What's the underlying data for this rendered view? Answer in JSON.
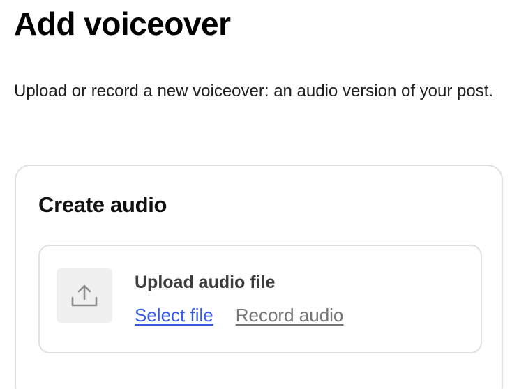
{
  "header": {
    "title": "Add voiceover",
    "description": "Upload or record a new voiceover: an audio version of your post."
  },
  "card": {
    "title": "Create audio",
    "upload": {
      "icon": "upload-icon",
      "label": "Upload audio file",
      "select_file_label": "Select file",
      "record_audio_label": "Record audio"
    }
  },
  "colors": {
    "primary_link": "#3858e9",
    "secondary_link": "#757575",
    "border": "#e0e0e0",
    "icon_tile": "#f0f0f0"
  }
}
